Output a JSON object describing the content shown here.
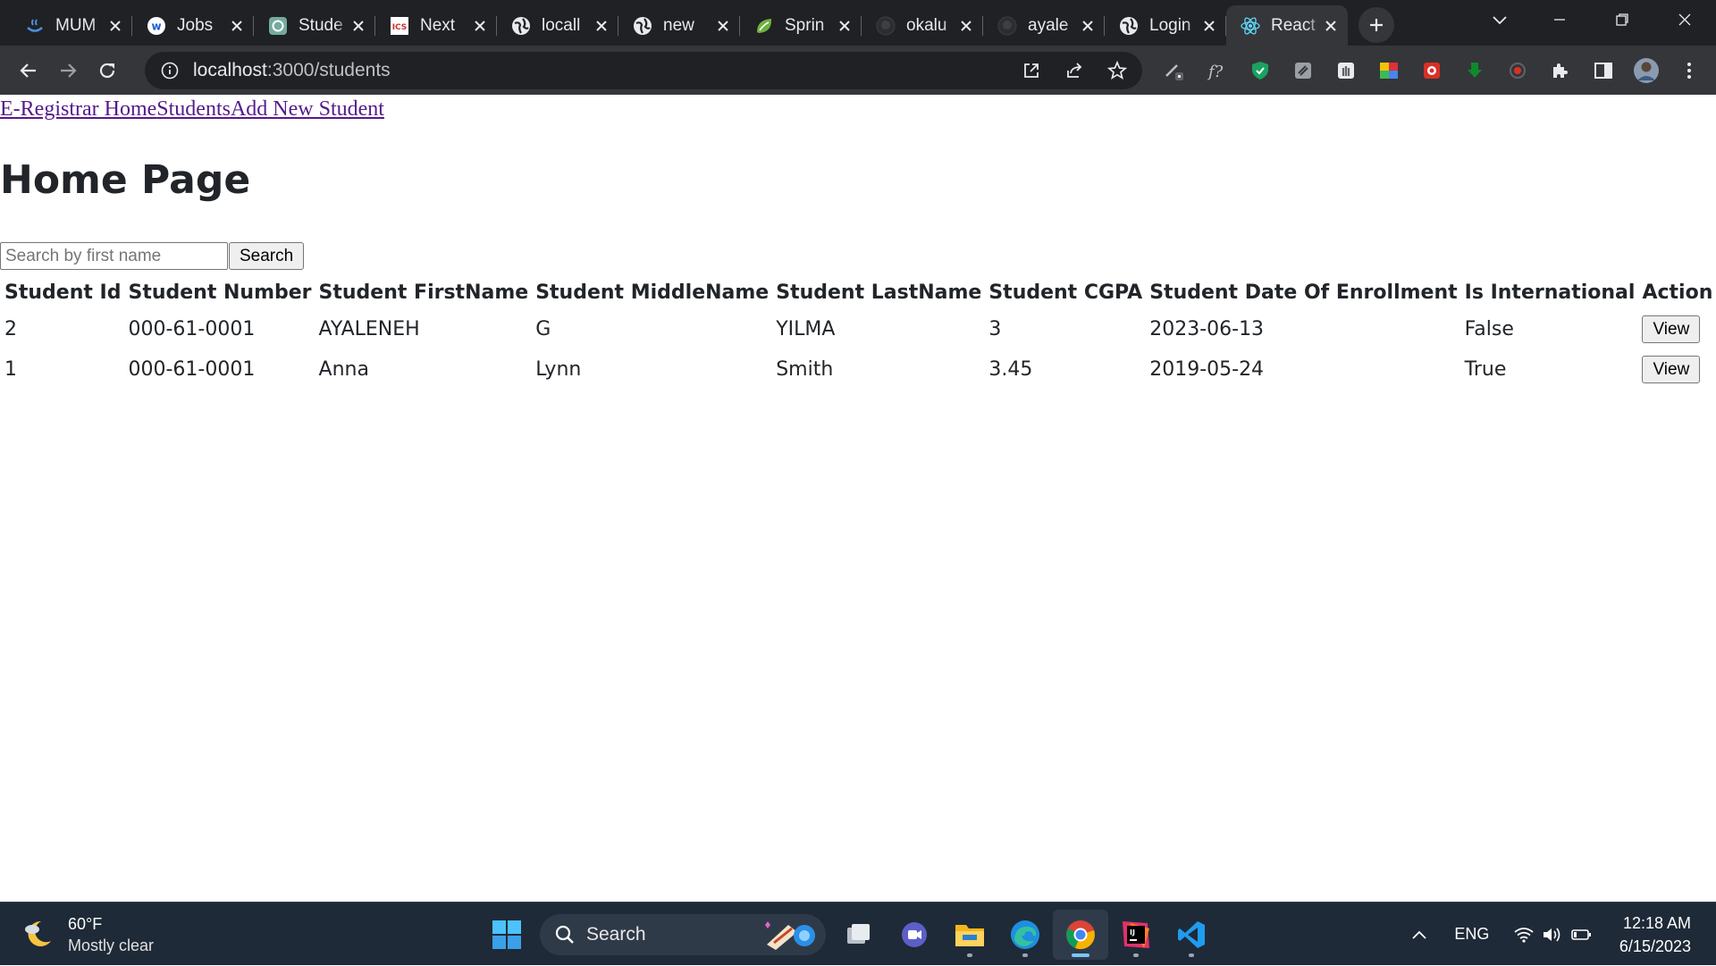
{
  "browser": {
    "tabs": [
      {
        "title": "MUM",
        "icon": "coffee-icon"
      },
      {
        "title": "Jobs",
        "icon": "w-logo-icon"
      },
      {
        "title": "Stude",
        "icon": "chatgpt-icon"
      },
      {
        "title": "Next",
        "icon": "ics-icon"
      },
      {
        "title": "locall",
        "icon": "globe-icon"
      },
      {
        "title": "new",
        "icon": "globe-icon"
      },
      {
        "title": "Sprin",
        "icon": "spring-icon"
      },
      {
        "title": "okalu",
        "icon": "github-icon"
      },
      {
        "title": "ayale",
        "icon": "github-icon"
      },
      {
        "title": "Login",
        "icon": "globe-icon"
      },
      {
        "title": "React",
        "icon": "react-icon",
        "active": true
      }
    ],
    "url_host": "localhost",
    "url_path": ":3000/students"
  },
  "page": {
    "nav": {
      "brand": "E-Registrar Home",
      "students": "Students",
      "add_new": "Add New Student"
    },
    "title": "Home Page",
    "search": {
      "placeholder": "Search by first name",
      "button": "Search"
    },
    "table": {
      "headers": [
        "Student Id",
        "Student Number",
        "Student FirstName",
        "Student MiddleName",
        "Student LastName",
        "Student CGPA",
        "Student Date Of Enrollment",
        "Is International",
        "Action"
      ],
      "rows": [
        {
          "id": "2",
          "number": "000-61-0001",
          "first": "AYALENEH",
          "middle": "G",
          "last": "YILMA",
          "cgpa": "3",
          "enrolled": "2023-06-13",
          "international": "False",
          "action": "View"
        },
        {
          "id": "1",
          "number": "000-61-0001",
          "first": "Anna",
          "middle": "Lynn",
          "last": "Smith",
          "cgpa": "3.45",
          "enrolled": "2019-05-24",
          "international": "True",
          "action": "View"
        }
      ]
    }
  },
  "taskbar": {
    "weather_temp": "60°F",
    "weather_desc": "Mostly clear",
    "search_label": "Search",
    "language": "ENG",
    "time": "12:18 AM",
    "date": "6/15/2023"
  },
  "colors": {
    "tab_strip": "#202124",
    "toolbar": "#35363a",
    "link": "#551a8b",
    "taskbar": "#1f2a38"
  }
}
